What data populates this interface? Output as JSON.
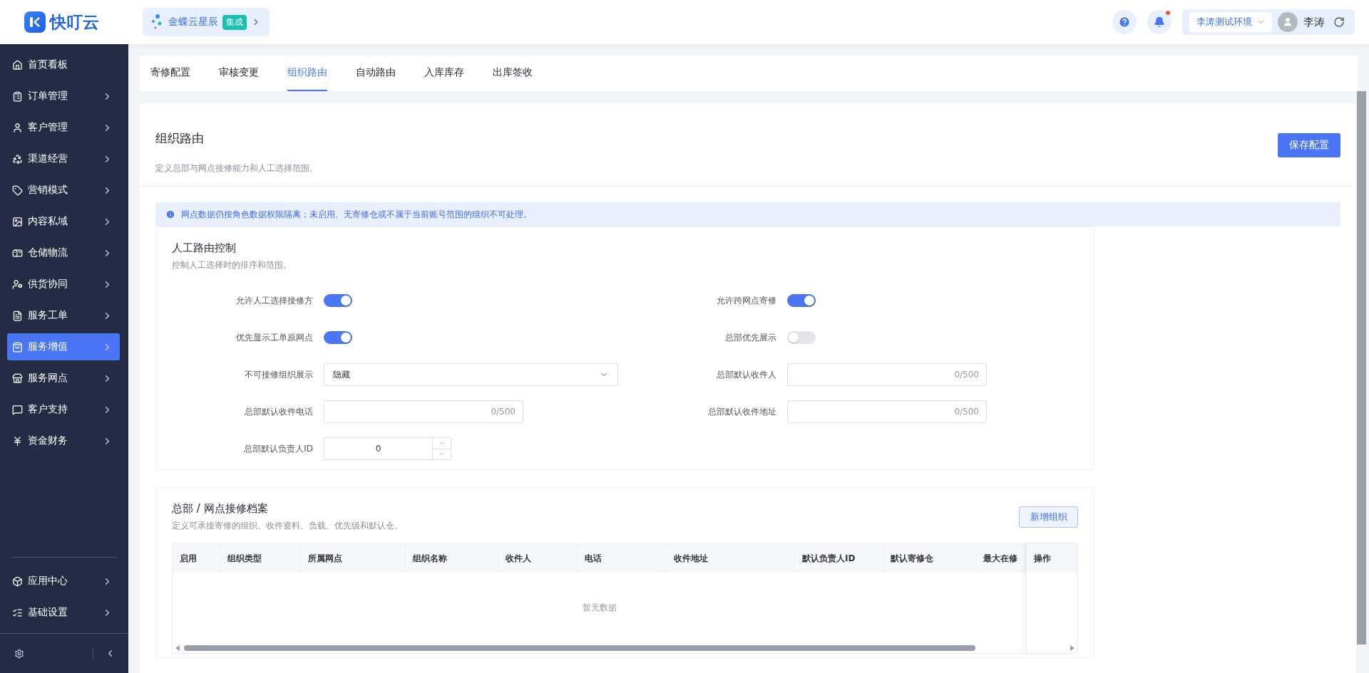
{
  "logo": {
    "text": "快叮云"
  },
  "tenant": {
    "name": "金蝶云星辰",
    "badge": "集成"
  },
  "header": {
    "notification_dot": true,
    "environment": "李涛测试环境",
    "user": "李涛"
  },
  "sidebar": {
    "items": [
      {
        "label": "首页看板",
        "selected": false,
        "expandable": false
      },
      {
        "label": "订单管理",
        "selected": false,
        "expandable": true
      },
      {
        "label": "客户管理",
        "selected": false,
        "expandable": true
      },
      {
        "label": "渠道经营",
        "selected": false,
        "expandable": true
      },
      {
        "label": "营销模式",
        "selected": false,
        "expandable": true
      },
      {
        "label": "内容私域",
        "selected": false,
        "expandable": true
      },
      {
        "label": "仓储物流",
        "selected": false,
        "expandable": true
      },
      {
        "label": "供货协同",
        "selected": false,
        "expandable": true
      },
      {
        "label": "服务工单",
        "selected": false,
        "expandable": true
      },
      {
        "label": "服务增值",
        "selected": true,
        "expandable": true
      },
      {
        "label": "服务网点",
        "selected": false,
        "expandable": true
      },
      {
        "label": "客户支持",
        "selected": false,
        "expandable": true
      },
      {
        "label": "资金财务",
        "selected": false,
        "expandable": true
      }
    ],
    "bottom_items": [
      {
        "label": "应用中心",
        "selected": false,
        "expandable": true
      },
      {
        "label": "基础设置",
        "selected": false,
        "expandable": true
      }
    ]
  },
  "tabs": [
    {
      "label": "寄修配置",
      "selected": false
    },
    {
      "label": "审核变更",
      "selected": false
    },
    {
      "label": "组织路由",
      "selected": true
    },
    {
      "label": "自动路由",
      "selected": false
    },
    {
      "label": "入库库存",
      "selected": false
    },
    {
      "label": "出库签收",
      "selected": false
    }
  ],
  "page": {
    "title": "组织路由",
    "description": "定义总部与网点接修能力和人工选择范围。",
    "save_button": "保存配置"
  },
  "alert": "网点数据仍按角色数据权限隔离；未启用、无寄修仓或不属于当前账号范围的组织不可处理。",
  "routing_control": {
    "title": "人工路由控制",
    "description": "控制人工选择时的排序和范围。",
    "fields": [
      {
        "kind": "switch",
        "label": "允许人工选择接修方",
        "on": true
      },
      {
        "kind": "switch",
        "label": "允许跨网点寄修",
        "on": true
      },
      {
        "kind": "switch",
        "label": "优先显示工单原网点",
        "on": true
      },
      {
        "kind": "switch",
        "label": "总部优先展示",
        "on": false
      },
      {
        "kind": "select",
        "label": "不可接修组织展示",
        "value": "隐藏"
      },
      {
        "kind": "text",
        "label": "总部默认收件人",
        "counter": "0/500"
      },
      {
        "kind": "text",
        "label": "总部默认收件电话",
        "counter": "0/500"
      },
      {
        "kind": "text",
        "label": "总部默认收件地址",
        "counter": "0/500"
      },
      {
        "kind": "number",
        "label": "总部默认负责人ID",
        "value": "0"
      }
    ]
  },
  "archive": {
    "title": "总部 / 网点接修档案",
    "description": "定义可承接寄修的组织、收件资料、负载、优先级和默认仓。",
    "add_button": "新增组织",
    "table": {
      "columns": [
        "启用",
        "组织类型",
        "所属网点",
        "组织名称",
        "收件人",
        "电话",
        "收件地址",
        "默认负责人ID",
        "默认寄修仓",
        "最大在修"
      ],
      "fixed_column": "操作",
      "empty_text": "暂无数据"
    }
  }
}
